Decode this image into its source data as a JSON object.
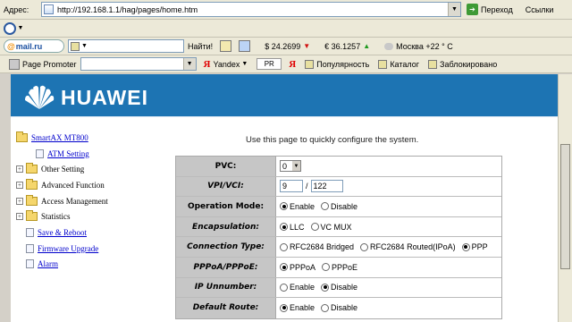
{
  "browser": {
    "address_label": "Адрес:",
    "url": "http://192.168.1.1/hag/pages/home.htm",
    "go_label": "Переход",
    "links_label": "Ссылки"
  },
  "toolbar_mail": {
    "logo": "mail.ru",
    "find_label": "Найти!",
    "usd_rate": "$ 24.2699",
    "eur_rate": "€ 36.1257",
    "weather": "Москва +22 ° C"
  },
  "toolbar_yandex": {
    "page_promoter_label": "Page Promoter",
    "yandex_label": "Yandex",
    "pr_label": "PR",
    "popularity_label": "Популярность",
    "catalog_label": "Каталог",
    "blocked_label": "Заблокировано"
  },
  "page": {
    "brand": "HUAWEI",
    "intro": "Use this page to quickly configure the system.",
    "nav": [
      {
        "label": "SmartAX MT800"
      },
      {
        "label": "ATM Setting"
      },
      {
        "label": "Other Setting"
      },
      {
        "label": "Advanced Function"
      },
      {
        "label": "Access Management"
      },
      {
        "label": "Statistics"
      },
      {
        "label": "Save & Reboot"
      },
      {
        "label": "Firmware Upgrade"
      },
      {
        "label": "Alarm"
      }
    ],
    "config": {
      "pvc": {
        "label": "PVC:",
        "value": "0"
      },
      "vpi_vci": {
        "label": "VPI/VCI:",
        "vpi": "9",
        "separator": "/",
        "vci": "122"
      },
      "operation_mode": {
        "label": "Operation Mode:",
        "opt1": "Enable",
        "opt2": "Disable",
        "selected": "Enable"
      },
      "encapsulation": {
        "label": "Encapsulation:",
        "opt1": "LLC",
        "opt2": "VC MUX",
        "selected": "LLC"
      },
      "connection_type": {
        "label": "Connection Type:",
        "opt1": "RFC2684 Bridged",
        "opt2": "RFC2684 Routed(IPoA)",
        "opt3": "PPP",
        "selected": "PPP"
      },
      "pppoa_pppoe": {
        "label": "PPPoA/PPPoE:",
        "opt1": "PPPoA",
        "opt2": "PPPoE",
        "selected": "PPPoA"
      },
      "ip_unnumber": {
        "label": "IP Unnumber:",
        "opt1": "Enable",
        "opt2": "Disable",
        "selected": "Disable"
      },
      "default_route": {
        "label": "Default Route:",
        "opt1": "Enable",
        "opt2": "Disable",
        "selected": "Enable"
      }
    }
  }
}
